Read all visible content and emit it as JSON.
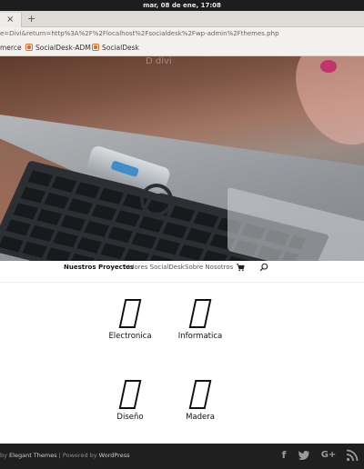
{
  "system_bar": {
    "clock": "mar, 08 de ene, 17:08"
  },
  "browser": {
    "close_tab_glyph": "×",
    "new_tab_glyph": "+",
    "url": "e=Divi&return=http%3A%2F%2Flocalhost%2Fsocialdesk%2Fwp-admin%2Fthemes.php",
    "bookmarks": [
      {
        "label": "merce",
        "icon": ""
      },
      {
        "label": "SocialDesk-ADM",
        "icon": "site-icon"
      },
      {
        "label": "SocialDesk",
        "icon": "site-icon"
      }
    ]
  },
  "hero": {
    "logo_text": "D divi"
  },
  "nav": {
    "items": [
      {
        "label": "Nuestros Proyectos",
        "active": true
      },
      {
        "label": "Valores SocialDesk",
        "active": false
      },
      {
        "label": "Sobre Nosotros",
        "active": false
      }
    ],
    "cart_icon": "cart-icon",
    "search_icon": "search-icon"
  },
  "categories": [
    {
      "label": "Electronica"
    },
    {
      "label": "Informatica"
    },
    {
      "label": "Diseño"
    },
    {
      "label": "Madera"
    }
  ],
  "footer": {
    "prefix": "by ",
    "theme": "Elegant Themes",
    "separator": " | Powered by ",
    "platform": "WordPress",
    "social": [
      "facebook-icon",
      "twitter-icon",
      "google-plus-icon",
      "rss-icon"
    ]
  }
}
